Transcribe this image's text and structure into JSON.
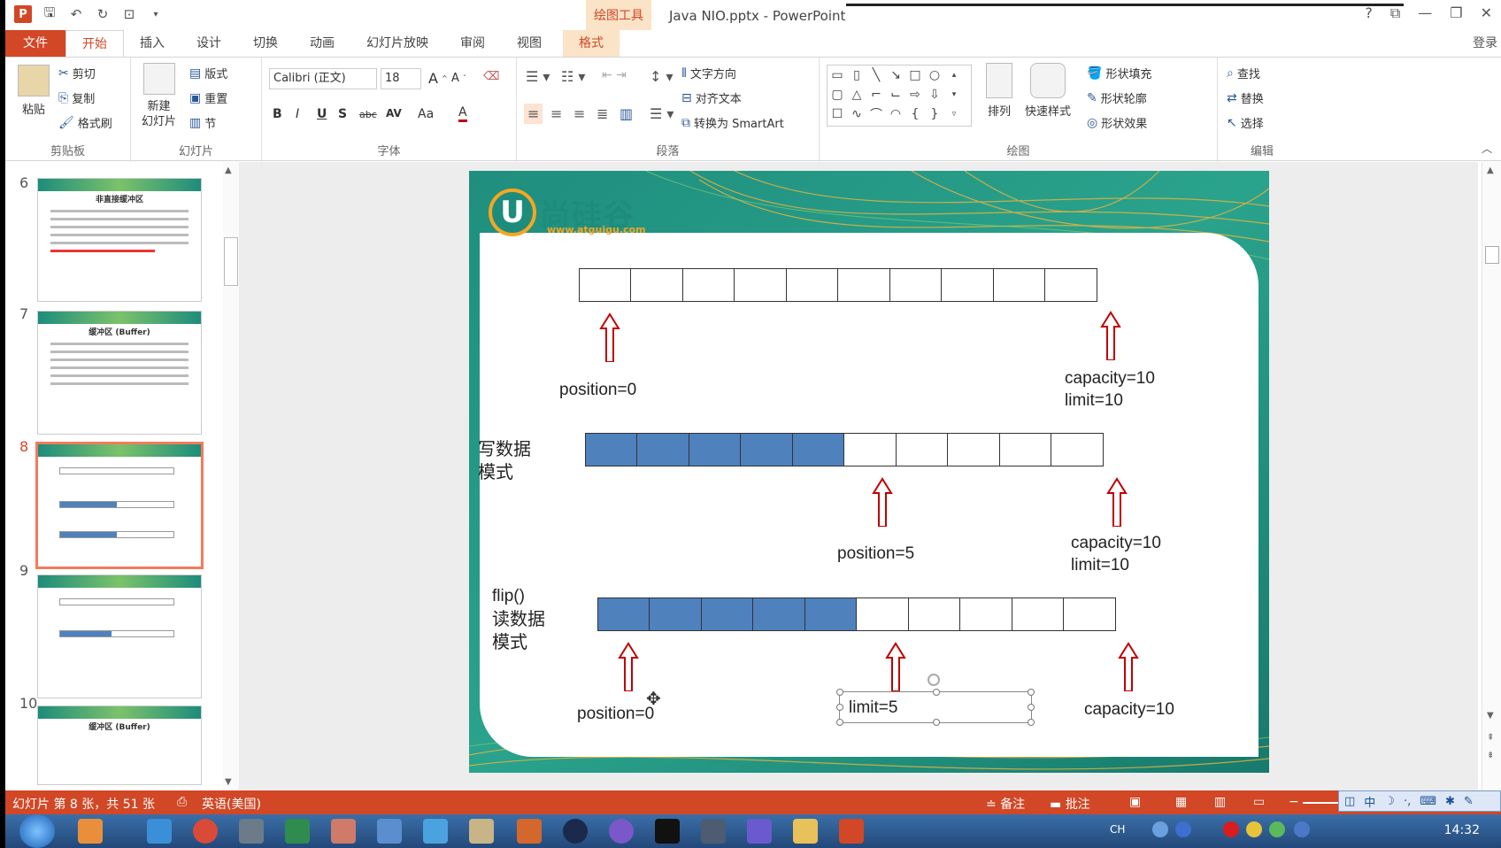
{
  "window": {
    "doc_title": "Java NIO.pptx - PowerPoint",
    "context_tool": "绘图工具",
    "controls": [
      "?",
      "⧉",
      "—",
      "❐",
      "✕"
    ],
    "login": "登录"
  },
  "tabs": [
    "文件",
    "开始",
    "插入",
    "设计",
    "切换",
    "动画",
    "幻灯片放映",
    "审阅",
    "视图",
    "格式"
  ],
  "ribbon": {
    "clipboard": {
      "label": "剪贴板",
      "paste": "粘贴",
      "cut": "剪切",
      "copy": "复制",
      "format_painter": "格式刷"
    },
    "slides": {
      "label": "幻灯片",
      "new_slide": "新建",
      "new_slide_2": "幻灯片",
      "layout": "版式",
      "reset": "重置",
      "section": "节"
    },
    "font": {
      "label": "字体",
      "font_name": "Calibri (正文)",
      "font_size": "18",
      "bold": "B",
      "italic": "I",
      "underline": "U",
      "shadow": "S",
      "strike": "abc",
      "spacing": "AV",
      "case": "Aa",
      "color": "A"
    },
    "paragraph": {
      "label": "段落",
      "text_direction": "文字方向",
      "align_text": "对齐文本",
      "smartart": "转换为 SmartArt"
    },
    "drawing": {
      "label": "绘图",
      "arrange": "排列",
      "quick_styles": "快速样式",
      "shape_fill": "形状填充",
      "shape_outline": "形状轮廓",
      "shape_effects": "形状效果"
    },
    "editing": {
      "label": "编辑",
      "find": "查找",
      "replace": "替换",
      "select": "选择"
    }
  },
  "thumbnails": [
    {
      "number": "6",
      "title": "非直接缓冲区"
    },
    {
      "number": "7",
      "title": "缓冲区 (Buffer)"
    },
    {
      "number": "8",
      "title": ""
    },
    {
      "number": "9",
      "title": ""
    },
    {
      "number": "10",
      "title": "缓冲区 (Buffer)"
    }
  ],
  "slide": {
    "logo_name": "尚硅谷",
    "logo_url": "www.atguigu.com",
    "section1": {
      "filled": 0,
      "total": 10,
      "position": "position=0",
      "capacity": "capacity=10",
      "limit": "limit=10"
    },
    "section2": {
      "mode_line1": "写数据",
      "mode_line2": "模式",
      "filled": 5,
      "total": 10,
      "position": "position=5",
      "capacity": "capacity=10",
      "limit": "limit=10"
    },
    "section3": {
      "flip": "flip()",
      "mode_line1": "读数据",
      "mode_line2": "模式",
      "filled": 5,
      "total": 10,
      "position": "position=0",
      "limit": "limit=5",
      "capacity": "capacity=10"
    }
  },
  "statusbar": {
    "slide_info": "幻灯片 第 8 张，共 51 张",
    "language": "英语(美国)",
    "notes": "备注",
    "comments": "批注"
  },
  "taskbar": {
    "time": "14:32",
    "ime": "CH"
  },
  "colors": {
    "accent": "#d24726",
    "buffer_fill": "#4f81bd",
    "arrow": "#c00000",
    "slide_teal": "#1d8c7c"
  }
}
